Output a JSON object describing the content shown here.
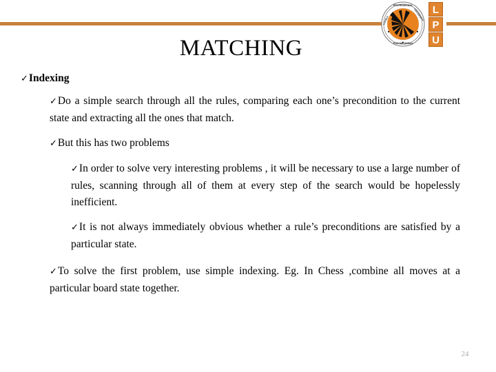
{
  "slide": {
    "title": "MATCHING",
    "page_number": "24",
    "accent_color": "#C8813C",
    "logo_box_color": "#E0842E",
    "bullet_glyph": "✓"
  },
  "logo": {
    "name": "lpu-logo",
    "seal_text_top": "PROFESSIONAL UNIVERSITY",
    "seal_text_left": "LOVELY",
    "seal_text_bottom": "PUNJAB (INDIA)",
    "letters": [
      "L",
      "P",
      "U"
    ]
  },
  "content": {
    "bullets": [
      {
        "level": 1,
        "text": "Indexing"
      },
      {
        "level": 2,
        "text": "Do a simple search through all the rules, comparing each one’s precondition to the current state and extracting all the ones that match."
      },
      {
        "level": 2,
        "text": "But this has two problems"
      },
      {
        "level": 3,
        "text": "In order to solve very interesting problems , it will be necessary to use a large number of rules, scanning through all of them at every step of the search would be hopelessly inefficient."
      },
      {
        "level": 3,
        "text": "It is not always immediately obvious whether a rule’s preconditions are satisfied by a particular state."
      },
      {
        "level": 2,
        "text": "To solve the first problem, use simple indexing. Eg. In Chess ,combine all moves at a particular board state together."
      }
    ]
  }
}
